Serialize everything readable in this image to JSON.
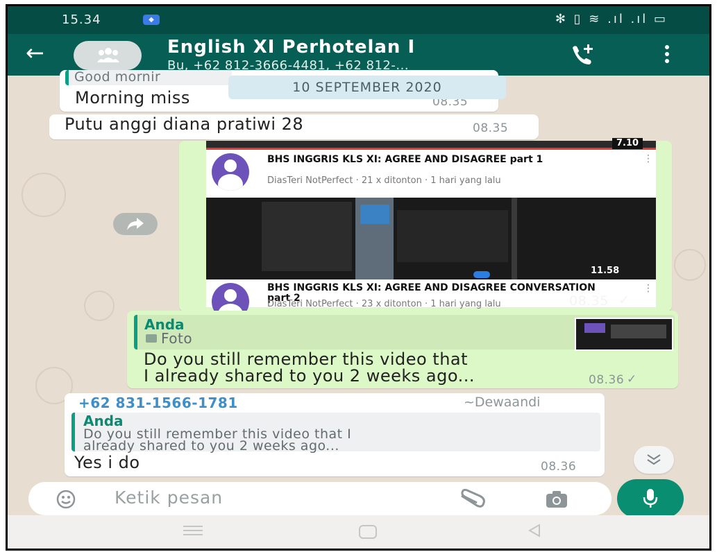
{
  "status_bar": {
    "time": "15.34",
    "indicators": "✻ ▯ ≋ .ıl .ıl ▭"
  },
  "header": {
    "title": "English XI Perhotelan I",
    "subtitle": "Bu, +62 812-3666-4481, +62 812-..."
  },
  "date_chip": "10 SEPTEMBER 2020",
  "messages": {
    "m1": {
      "quote_preview": "Good mornir",
      "text": "Morning miss",
      "time": "08.35"
    },
    "m2": {
      "text": "Putu anggi diana pratiwi 28",
      "time": "08.35"
    },
    "m3": {
      "video1_duration": "7.10",
      "video1_title": "BHS INGGRIS KLS XI: AGREE AND DISAGREE part 1",
      "video1_meta": "DiasTeri NotPerfect · 21 x ditonton · 1 hari yang lalu",
      "video2_duration": "11.58",
      "video2_title": "BHS INGGRIS KLS XI: AGREE AND DISAGREE CONVERSATION part 2",
      "video2_meta": "DiasTeri NotPerfect · 23 x ditonton · 1 hari yang lalu",
      "time": "08.35",
      "tick": "✓"
    },
    "m4": {
      "quote_author": "Anda",
      "quote_type": "Foto",
      "text_line1": "Do you still remember this video that",
      "text_line2": "I already shared to you 2 weeks ago...",
      "time": "08.36",
      "tick": "✓"
    },
    "m5": {
      "sender": "+62 831-1566-1781",
      "sender_name": "~Dewaandi",
      "quote_author": "Anda",
      "quote_line1": "Do you still remember this video that I",
      "quote_line2": "already shared to you 2 weeks ago...",
      "text": "Yes i do",
      "time": "08.36"
    }
  },
  "input": {
    "placeholder": "Ketik pesan"
  },
  "colors": {
    "header": "#075e54",
    "status_bar": "#054d44",
    "outgoing_bubble": "#dcf8c6",
    "accent_green": "#0a8e72",
    "wallpaper": "#e8ddd1"
  }
}
